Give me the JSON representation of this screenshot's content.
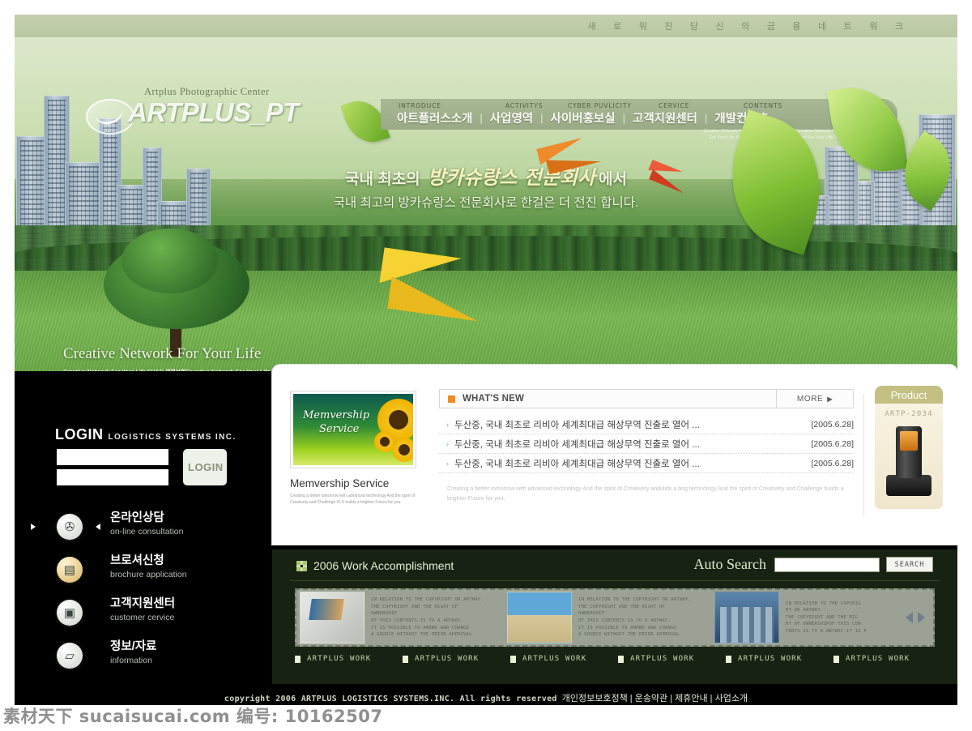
{
  "topbar": {
    "tagline": "새 로 워 진   당 신 의   금 융   네 트 워 크"
  },
  "logo": {
    "sub": "Artplus Photographic Center",
    "name": "ARTPLUS_PT",
    "mark_icon": "swirl-logo-icon"
  },
  "nav": {
    "items": [
      {
        "en": "INTRODUCE",
        "kr": "아트플러스소개"
      },
      {
        "en": "ACTIVITYS",
        "kr": "사업영역"
      },
      {
        "en": "CYBER PUVLICITY",
        "kr": "사이버홍보실"
      },
      {
        "en": "CERVICE",
        "kr": "고객지원센터"
      },
      {
        "en": "CONTENTS",
        "kr": "개발컨텐츠"
      }
    ],
    "separator": "|"
  },
  "hero": {
    "headline_prefix": "국내 최초의 ",
    "headline_fancy": "방카슈랑스 전문회사",
    "headline_suffix": "에서",
    "subheadline": "국내 최고의 방카슈랑스 전문회사로 한걸은 더 전진 합니다.",
    "faint_right": "Creative Network For Your Life SH&C 생명보험Cr eative Network For Your Life  reative Network For Your Life SH SH&C 생명보험creative Network For Your Life SHreative Network For Your",
    "creative_title": "Creative Network For Your Life",
    "creative_body": "Creative Network For Your Life SH&C 생명보험Cr eative Network For Your Life  reative Network For Your Life SH H&C 생명보험creative Network For Your Life SHreative Network For Your Life SH"
  },
  "login": {
    "title": "LOGIN",
    "subtitle": "LOGISTICS SYSTEMS INC.",
    "id_value": "",
    "id_placeholder": "",
    "pw_value": "",
    "pw_placeholder": "",
    "button_label": "LOGIN"
  },
  "sidebar_menu": [
    {
      "kr": "온라인상담",
      "en": "on-line consultation",
      "icon": "megaphone-icon",
      "glyph": "📣",
      "gold": false,
      "selected": true
    },
    {
      "kr": "브로셔신청",
      "en": "brochure application",
      "icon": "book-icon",
      "glyph": "📙",
      "gold": true,
      "selected": false
    },
    {
      "kr": "고객지원센터",
      "en": " customer cervice",
      "icon": "headset-icon",
      "glyph": "📠",
      "gold": false,
      "selected": false
    },
    {
      "kr": "정보/자료",
      "en": "information",
      "icon": "documents-icon",
      "glyph": "📄",
      "gold": false,
      "selected": false
    }
  ],
  "membership": {
    "image_caption_line1": "Memvership",
    "image_caption_line2": "Service",
    "title": "Memvership Service",
    "body": "Creating a better tomorrow with advanced technology And the spirit of Creativety and Challenge  KLS bulids a brighter Future for you"
  },
  "whats_new": {
    "title": "WHAT'S NEW",
    "more_label": "MORE",
    "more_arrow": "▶",
    "bullet": "›",
    "items": [
      {
        "text": "두산중, 국내 최초로 리비아 세계최대급 해상무역 진출로 열어 ...",
        "date": "[2005.6.28]"
      },
      {
        "text": "두산중, 국내 최초로 리비아 세계최대급 해상무역 진출로 열어 ...",
        "date": "[2005.6.28]"
      },
      {
        "text": "두산중, 국내 최초로 리비아 세계최대급 해상무역 진출로 열어 ...",
        "date": "[2005.6.28]"
      }
    ],
    "blurb": "Creating a better tomorrow with advanced technology And the spirit of   Creativety andulids a brig technology And the spirit of   Creativety and Challenge   bulids a brighter Future for you,"
  },
  "product": {
    "tab_label": "Product",
    "code": "ARTP-2034"
  },
  "work": {
    "title": "2006 Work Accomplishment",
    "search_label": "Auto Search",
    "search_value": "",
    "search_placeholder": "",
    "search_button": "SEARCH",
    "cells": [
      {
        "thumb": "laptop-thumb",
        "copy": "IN RELATION TO THE COPYRIGHT OR ARTWAY.\nTHE COPYRIGHT AND THE RIGHT OF OWNERSHIP\nOF THIS CONTENTS IS TO A ARTWAY.\nIT IS POSSIBLE TO AMEND AND CHANGE\nA SOURCE WITHOUT THE PRIOR APPROVAL"
      },
      {
        "thumb": "beach-thumb",
        "copy": "IN RELATION TO THE COPYRIGHT OR ARTWAY.\nTHE COPYRIGHT AND THE RIGHT OF OWNERSHIP\nOF THIS CONTENTS IS TO A ARTWAY.\nIT IS POSSIBLE TO AMEND AND CHANGE\nA SOURCE WITHOUT THE PRIOR APPROVAL"
      },
      {
        "thumb": "city-thumb",
        "copy": "IN RELATION TO THE COPYRIG\nHT OR ARTWAY.\nTHE COPYRIGHT AND THE RIG\nHT OF OWNERSHIPOF THIS CON\nTENTS IS TO A ARTWAY.IT IS P"
      }
    ],
    "prev_arrow_icon": "left-arrow-icon",
    "next_arrow_icon": "right-arrow-icon",
    "tags": [
      "ARTPLUS WORK",
      "ARTPLUS WORK",
      "ARTPLUS WORK",
      "ARTPLUS WORK",
      "ARTPLUS WORK",
      "ARTPLUS WORK"
    ]
  },
  "footer": {
    "copyright": "copyright   2006 ARTPLUS LOGISTICS SYSTEMS.INC. All rights reserved",
    "links": "개인정보보호정책 | 운송약관 | 제휴안내  | 사업소개"
  },
  "watermark": "素材天下 sucaisucai.com  编号: 10162507",
  "colors": {
    "accent_orange": "#f08c20",
    "nav_green": "#9aaa86",
    "dark_panel": "#182213",
    "top_strip": "#bac8a3"
  }
}
